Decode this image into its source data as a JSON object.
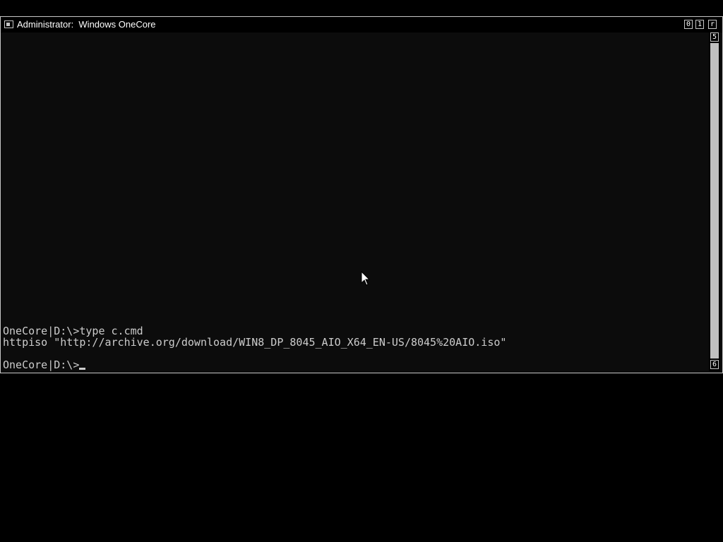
{
  "window": {
    "title": "Administrator:  Windows OneCore",
    "buttons": {
      "minimize": "0",
      "maximize": "1",
      "close": "r"
    }
  },
  "console": {
    "lines": [
      "OneCore|D:\\>type c.cmd",
      "httpiso \"http://archive.org/download/WIN8_DP_8045_AIO_X64_EN-US/8045%20AIO.iso\"",
      "OneCore|D:\\>"
    ]
  },
  "scrollbar": {
    "up": "5",
    "down": "6"
  },
  "icons": {
    "app": "console-window-icon",
    "pointer": "mouse-pointer-icon"
  }
}
